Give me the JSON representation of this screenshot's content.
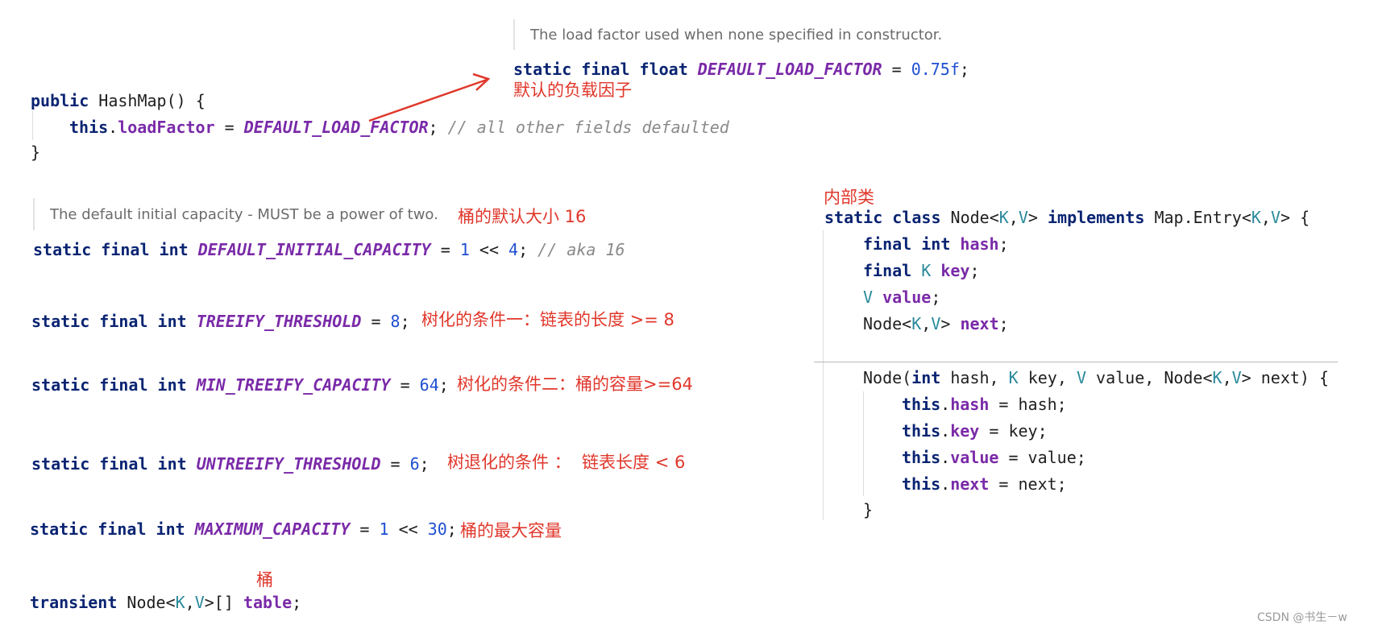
{
  "load_factor_doc": "The load factor used when none specified in constructor.",
  "load_factor_line": {
    "kw": "static final float ",
    "name": "DEFAULT_LOAD_FACTOR",
    "eq": " = ",
    "value": "0.75f",
    "end": ";"
  },
  "load_factor_note": "默认的负载因子",
  "constructor": {
    "kw_public": "public",
    "sig": " HashMap() {",
    "kw_this": "this",
    "dot": ".",
    "field": "loadFactor",
    "eq": " = ",
    "const": "DEFAULT_LOAD_FACTOR",
    "semi": "; ",
    "comment": "// all other fields defaulted",
    "close": "}"
  },
  "capacity_doc": "The default initial capacity - MUST be a power of two.",
  "capacity_note": "桶的默认大小 16",
  "capacity_line": {
    "kw": "static final int ",
    "name": "DEFAULT_INITIAL_CAPACITY",
    "eq": " = ",
    "v1": "1",
    "op": " << ",
    "v2": "4",
    "semi": "; ",
    "comment": "// aka 16"
  },
  "treeify_line": {
    "kw": "static final int ",
    "name": "TREEIFY_THRESHOLD",
    "eq": " = ",
    "value": "8",
    "semi": ";"
  },
  "treeify_note": "树化的条件一：链表的长度 >= 8",
  "min_treeify_line": {
    "kw": "static final int ",
    "name": "MIN_TREEIFY_CAPACITY",
    "eq": " = ",
    "value": "64",
    "semi": ";"
  },
  "min_treeify_note": "树化的条件二：桶的容量>=64",
  "untreeify_line": {
    "kw": "static final int ",
    "name": "UNTREEIFY_THRESHOLD",
    "eq": " = ",
    "value": "6",
    "semi": ";"
  },
  "untreeify_note": "树退化的条件 ：  链表长度 < 6",
  "maximum_line": {
    "kw": "static final int ",
    "name": "MAXIMUM_CAPACITY",
    "eq": " = ",
    "v1": "1",
    "op": " << ",
    "v2": "30",
    "semi": ";"
  },
  "maximum_note": "桶的最大容量",
  "table_note": "桶",
  "table_line": {
    "kw": "transient",
    "type": " Node<",
    "k": "K",
    "comma": ",",
    "v": "V",
    "rest": ">[] ",
    "name": "table",
    "semi": ";"
  },
  "inner_class_note": "内部类",
  "node_class": {
    "kw": "static class",
    "name": " Node<",
    "k": "K",
    "comma": ",",
    "v": "V",
    "gt": "> ",
    "kw_impl": "implements",
    "iface": " Map.Entry<",
    "k2": "K",
    "comma2": ",",
    "v2": "V",
    "open": "> {",
    "f1_kw": "final int ",
    "f1_name": "hash",
    "f1_end": ";",
    "f2_kw": "final ",
    "f2_type": "K",
    "f2_sp": " ",
    "f2_name": "key",
    "f2_end": ";",
    "f3_type": "V",
    "f3_sp": " ",
    "f3_name": "value",
    "f3_end": ";",
    "f4_type": "Node<",
    "f4_k": "K",
    "f4_comma": ",",
    "f4_v": "V",
    "f4_gt": "> ",
    "f4_name": "next",
    "f4_end": ";",
    "ctor_name": "Node(",
    "ctor_int": "int",
    "ctor_p1": " hash, ",
    "ctor_k": "K",
    "ctor_p2": " key, ",
    "ctor_v": "V",
    "ctor_p3": " value, Node<",
    "ctor_k2": "K",
    "ctor_comma": ",",
    "ctor_v2": "V",
    "ctor_p4": "> next) {",
    "this": "this",
    "dot": ".",
    "a1_field": "hash",
    "a1_rest": " = hash;",
    "a2_field": "key",
    "a2_rest": " = key;",
    "a3_field": "value",
    "a3_rest": " = value;",
    "a4_field": "next",
    "a4_rest": " = next;",
    "close": "}"
  },
  "watermark": "CSDN @书生－w",
  "colors": {
    "keyword": "#0a2472",
    "constant": "#7a2aa8",
    "number": "#1f4fd1",
    "type_param": "#2b8a9c",
    "comment": "#8a8a8a",
    "annotation": "#e0372b"
  }
}
